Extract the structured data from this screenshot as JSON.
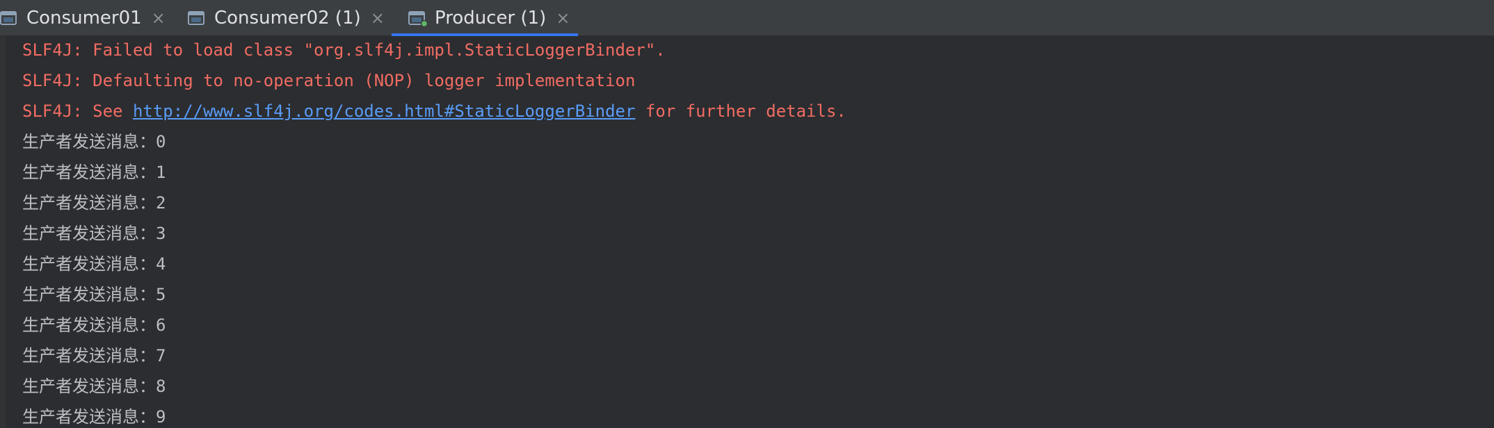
{
  "tabs": [
    {
      "label": "Consumer01",
      "close": "×",
      "active": false
    },
    {
      "label": "Consumer02 (1)",
      "close": "×",
      "active": false
    },
    {
      "label": "Producer (1)",
      "close": "×",
      "active": true
    }
  ],
  "icons": {
    "run_console": "console-window-icon",
    "running_indicator": "green-dot"
  },
  "colors": {
    "accent": "#3574f0",
    "error_text": "#f26c63",
    "link": "#5a9cf8",
    "stdout_text": "#bcbec4",
    "running_dot": "#5fb865"
  },
  "console": {
    "lines": [
      {
        "type": "err",
        "text": "SLF4J: Failed to load class \"org.slf4j.impl.StaticLoggerBinder\"."
      },
      {
        "type": "err",
        "text": "SLF4J: Defaulting to no-operation (NOP) logger implementation"
      },
      {
        "type": "err",
        "prefix": "SLF4J: See ",
        "link": "http://www.slf4j.org/codes.html#StaticLoggerBinder",
        "suffix": " for further details."
      },
      {
        "type": "out",
        "text": "生产者发送消息：0"
      },
      {
        "type": "out",
        "text": "生产者发送消息：1"
      },
      {
        "type": "out",
        "text": "生产者发送消息：2"
      },
      {
        "type": "out",
        "text": "生产者发送消息：3"
      },
      {
        "type": "out",
        "text": "生产者发送消息：4"
      },
      {
        "type": "out",
        "text": "生产者发送消息：5"
      },
      {
        "type": "out",
        "text": "生产者发送消息：6"
      },
      {
        "type": "out",
        "text": "生产者发送消息：7"
      },
      {
        "type": "out",
        "text": "生产者发送消息：8"
      },
      {
        "type": "out",
        "text": "生产者发送消息：9"
      }
    ]
  }
}
